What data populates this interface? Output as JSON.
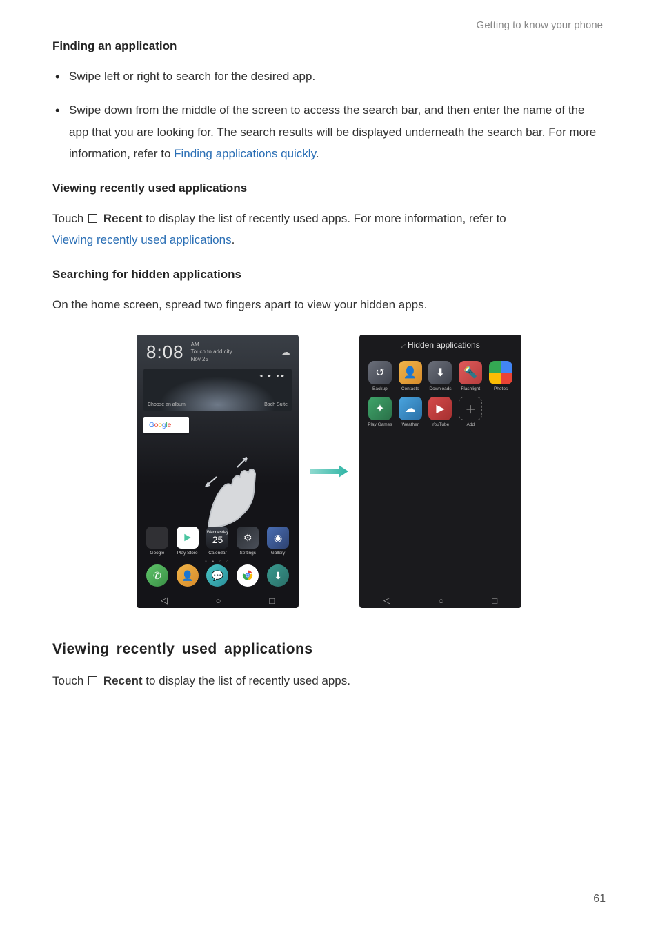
{
  "running_header": "Getting to know your phone",
  "sec1_heading": "Finding an application",
  "bullets": [
    "Swipe left or right to search for the desired app.",
    "Swipe down from the middle of the screen to access the search bar, and then enter the name of the app that you are looking for. The search results will be displayed underneath the search bar. For more information, refer to "
  ],
  "bullet2_link": "Finding applications quickly",
  "sec2_heading": "Viewing recently used applications",
  "sec2_para_pre": "Touch ",
  "sec2_recent_label": "Recent",
  "sec2_para_post": " to display the list of recently used apps. For more information, refer to ",
  "sec2_link": "Viewing recently used applications",
  "sec3_heading": "Searching for hidden applications",
  "sec3_para": "On the home screen, spread two fingers apart to view your hidden apps.",
  "h2_heading": "Viewing  recently  used  applications",
  "h2_para_pre": "Touch ",
  "h2_recent_label": "Recent",
  "h2_para_post": " to display the list of recently used apps.",
  "page_number": "61",
  "figure": {
    "home": {
      "time": "8:08",
      "ampm": "AM",
      "add_city": "Touch to add city",
      "date": "Nov 25",
      "album_left": "Choose an album",
      "album_right": "Bach Suite",
      "google_label": "Google",
      "apps": [
        {
          "label": "Google"
        },
        {
          "label": "Play Store"
        },
        {
          "label": "Calendar",
          "day": "25",
          "dow": "Wednesday"
        },
        {
          "label": "Settings"
        },
        {
          "label": "Gallery"
        }
      ],
      "dock": [
        "Phone",
        "Contacts",
        "Messaging",
        "Chrome",
        "Downloads"
      ]
    },
    "hidden": {
      "title": "Hidden applications",
      "apps": [
        {
          "label": "Backup"
        },
        {
          "label": "Contacts"
        },
        {
          "label": "Downloads"
        },
        {
          "label": "Flashlight"
        },
        {
          "label": "Photos"
        },
        {
          "label": "Play Games"
        },
        {
          "label": "Weather"
        },
        {
          "label": "YouTube"
        },
        {
          "label": "Add"
        }
      ]
    }
  }
}
